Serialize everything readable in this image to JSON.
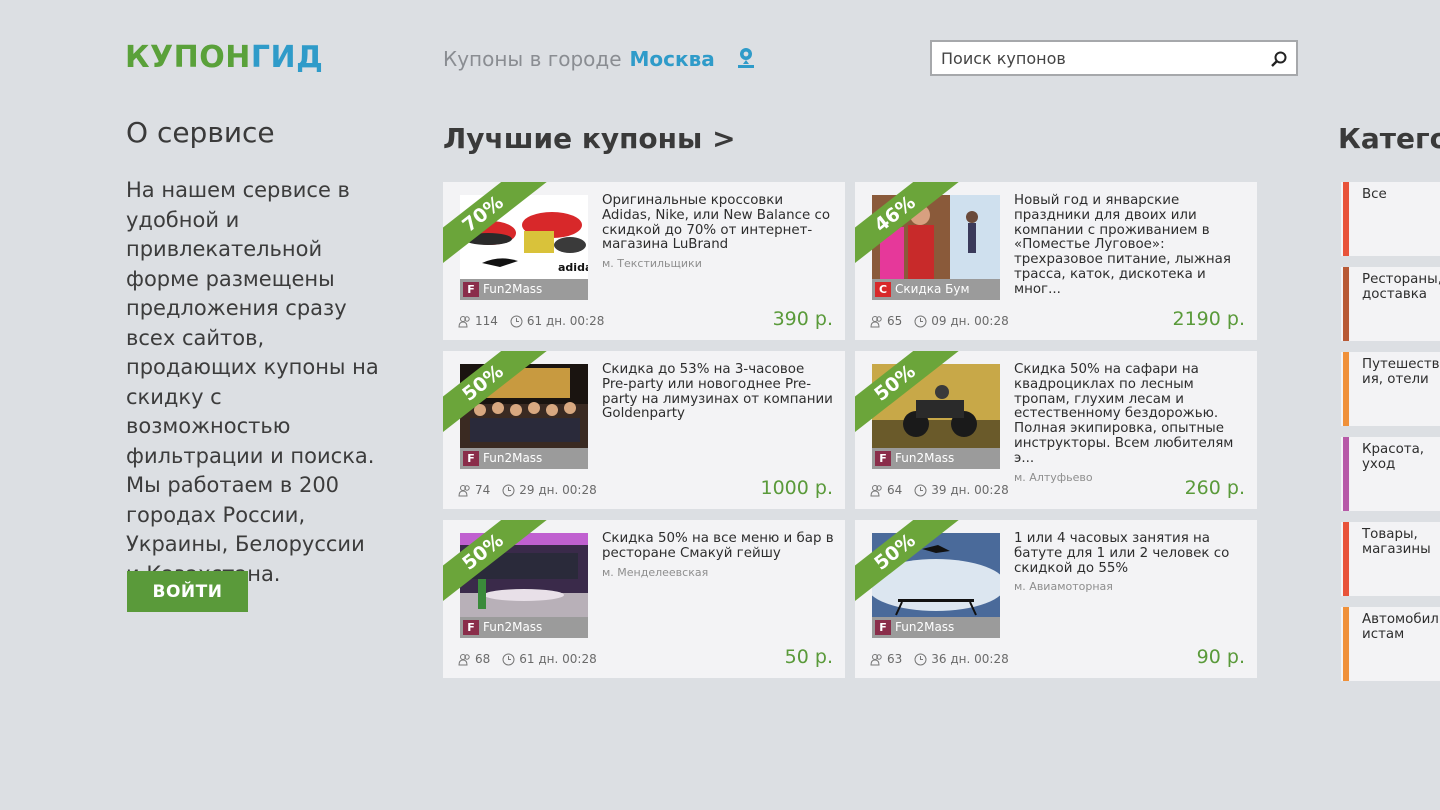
{
  "header": {
    "logo_part1": "КУПОН",
    "logo_part2": "ГИД",
    "city_label": "Купоны в городе",
    "city_name": "Москва",
    "search_placeholder": "Поиск купонов"
  },
  "about": {
    "title": "О сервисе",
    "text": "На нашем сервисе в удобной и привлекательной форме размещены предложения сразу всех сайтов, продающих купоны на скидку с возможностью фильтрации и поиска. Мы работаем в 200 городах России, Украины, Белоруссии и Казахстана.",
    "login_label": "ВОЙТИ"
  },
  "best": {
    "title": "Лучшие купоны >",
    "coupons": [
      {
        "discount": "70%",
        "title": "Оригинальные кроссовки Adidas, Nike, или New Balance со скидкой до 70% от интернет-магазина LuBrand",
        "metro": "м. Текстильщики",
        "provider": "Fun2Mass",
        "provider_letter": "F",
        "buyers": "114",
        "time": "61 дн. 00:28",
        "price": "390 р."
      },
      {
        "discount": "46%",
        "title": "Новый год и январские праздники для двоих или компании с проживанием в «Поместье Луговое»: трехразовое питание, лыжная трасса, каток, дискотека и мног...",
        "metro": "",
        "provider": "Скидка Бум",
        "provider_letter": "C",
        "buyers": "65",
        "time": "09 дн. 00:28",
        "price": "2190 р."
      },
      {
        "discount": "50%",
        "title": "Скидка до 53% на 3-часовое Pre-party или новогоднее Pre-party на лимузинах от компании Goldenparty",
        "metro": "",
        "provider": "Fun2Mass",
        "provider_letter": "F",
        "buyers": "74",
        "time": "29 дн. 00:28",
        "price": "1000 р."
      },
      {
        "discount": "50%",
        "title": "Скидка 50% на сафари на квадроциклах по лесным тропам, глухим лесам и естественному бездорожью. Полная экипировка, опытные инструкторы. Всем любителям э...",
        "metro": "м. Алтуфьево",
        "provider": "Fun2Mass",
        "provider_letter": "F",
        "buyers": "64",
        "time": "39 дн. 00:28",
        "price": "260 р."
      },
      {
        "discount": "50%",
        "title": "Скидка 50% на все меню и бар в ресторане  Смакуй гейшу",
        "metro": "м. Менделеевская",
        "provider": "Fun2Mass",
        "provider_letter": "F",
        "buyers": "68",
        "time": "61 дн. 00:28",
        "price": "50 р."
      },
      {
        "discount": "50%",
        "title": "1 или 4 часовых занятия на батуте для 1 или 2 человек со скидкой до 55%",
        "metro": "м. Авиамоторная",
        "provider": "Fun2Mass",
        "provider_letter": "F",
        "buyers": "63",
        "time": "36 дн. 00:28",
        "price": "90 р."
      }
    ]
  },
  "categories": {
    "title": "Категор",
    "items": [
      {
        "label": "Все",
        "color": "#e8533a"
      },
      {
        "label": "Рестораны, доставка",
        "color": "#b85a36"
      },
      {
        "label": "Путешеств ия, отели",
        "color": "#f0913a"
      },
      {
        "label": "Красота, уход",
        "color": "#b75aa8"
      },
      {
        "label": "Товары, магазины",
        "color": "#e8533a"
      },
      {
        "label": "Автомобил истам",
        "color": "#f0913a"
      }
    ]
  },
  "colors": {
    "accent_green": "#5a9a3a",
    "accent_blue": "#2f9bc9",
    "ribbon_green": "#6ba53a",
    "provider_fun2mass": "#8a2d4a",
    "provider_skidkabum": "#d8282a"
  }
}
